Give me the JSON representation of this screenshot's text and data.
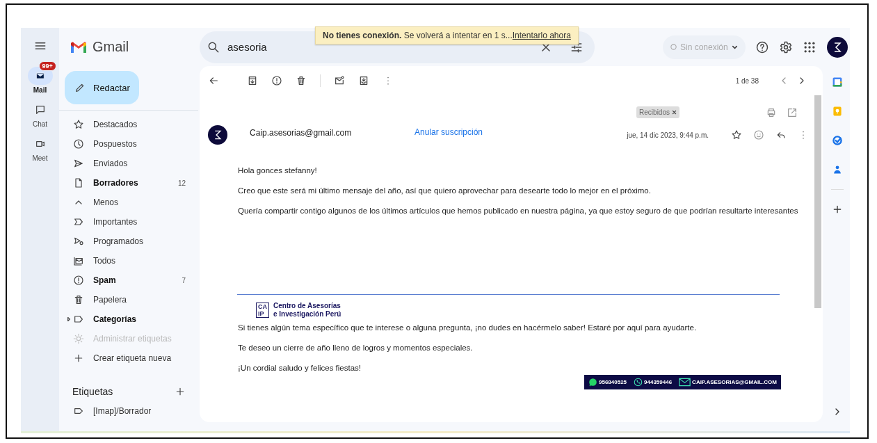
{
  "rail": [
    {
      "label": "Mail",
      "selected": true,
      "badge": "99+"
    },
    {
      "label": "Chat",
      "selected": false
    },
    {
      "label": "Meet",
      "selected": false
    }
  ],
  "app": {
    "name": "Gmail"
  },
  "compose": {
    "label": "Redactar"
  },
  "nav": [
    {
      "label": "Destacados",
      "unread": false,
      "disabled": false
    },
    {
      "label": "Pospuestos",
      "unread": false,
      "disabled": false
    },
    {
      "label": "Enviados",
      "unread": false,
      "disabled": false
    },
    {
      "label": "Borradores",
      "unread": true,
      "disabled": false,
      "count": "12"
    },
    {
      "label": "Menos",
      "unread": false,
      "disabled": false
    },
    {
      "label": "Importantes",
      "unread": false,
      "disabled": false
    },
    {
      "label": "Programados",
      "unread": false,
      "disabled": false
    },
    {
      "label": "Todos",
      "unread": false,
      "disabled": false
    },
    {
      "label": "Spam",
      "unread": true,
      "disabled": false,
      "count": "7"
    },
    {
      "label": "Papelera",
      "unread": false,
      "disabled": false
    },
    {
      "label": "Categorías",
      "unread": true,
      "disabled": false,
      "expanded": false
    },
    {
      "label": "Administrar etiquetas",
      "unread": false,
      "disabled": true
    },
    {
      "label": "Crear etiqueta nueva",
      "unread": false,
      "disabled": false
    }
  ],
  "labels": {
    "title": "Etiquetas",
    "items": [
      {
        "label": "[Imap]/Borrador"
      }
    ]
  },
  "search": {
    "value": "asesoria"
  },
  "offline_banner": {
    "title": "No tienes conexión.",
    "message": "Se volverá a intentar en 1 s...",
    "link": "Intentarlo ahora"
  },
  "status": {
    "label": "Sin conexión"
  },
  "toolbar": {
    "position": "1 de 38"
  },
  "message": {
    "label_chip": "Recibidos",
    "sender": "Caip.asesorias@gmail.com",
    "unsubscribe": "Anular suscripción",
    "date": "jue, 14 dic 2023, 9:44 p.m.",
    "starred": false,
    "paragraphs": [
      "Hola gonces stefanny!",
      "Creo que este será mi último mensaje del año, así que quiero aprovechar para desearte todo lo mejor en el próximo.",
      "Quería compartir contigo algunos de los últimos artículos que hemos publicado en nuestra página, ya que estoy seguro de que podrían resultarte interesantes"
    ],
    "signature": {
      "mark": [
        "CA",
        "IP"
      ],
      "name": [
        "Centro de Asesorías",
        "e Investigación Perú"
      ]
    },
    "closing": [
      "Si tienes algún tema específico que te interese o alguna pregunta, ¡no dudes en hacérmelo saber! Estaré por aquí para ayudarte.",
      "Te deseo un cierre de año lleno de logros y momentos especiales.",
      "¡Un cordial saludo y felices fiestas!"
    ],
    "contacts": [
      {
        "kind": "whatsapp",
        "text": "956840525"
      },
      {
        "kind": "phone",
        "text": "944359446"
      },
      {
        "kind": "email",
        "text": "CAIP.ASESORIAS@GMAIL.COM"
      }
    ]
  }
}
